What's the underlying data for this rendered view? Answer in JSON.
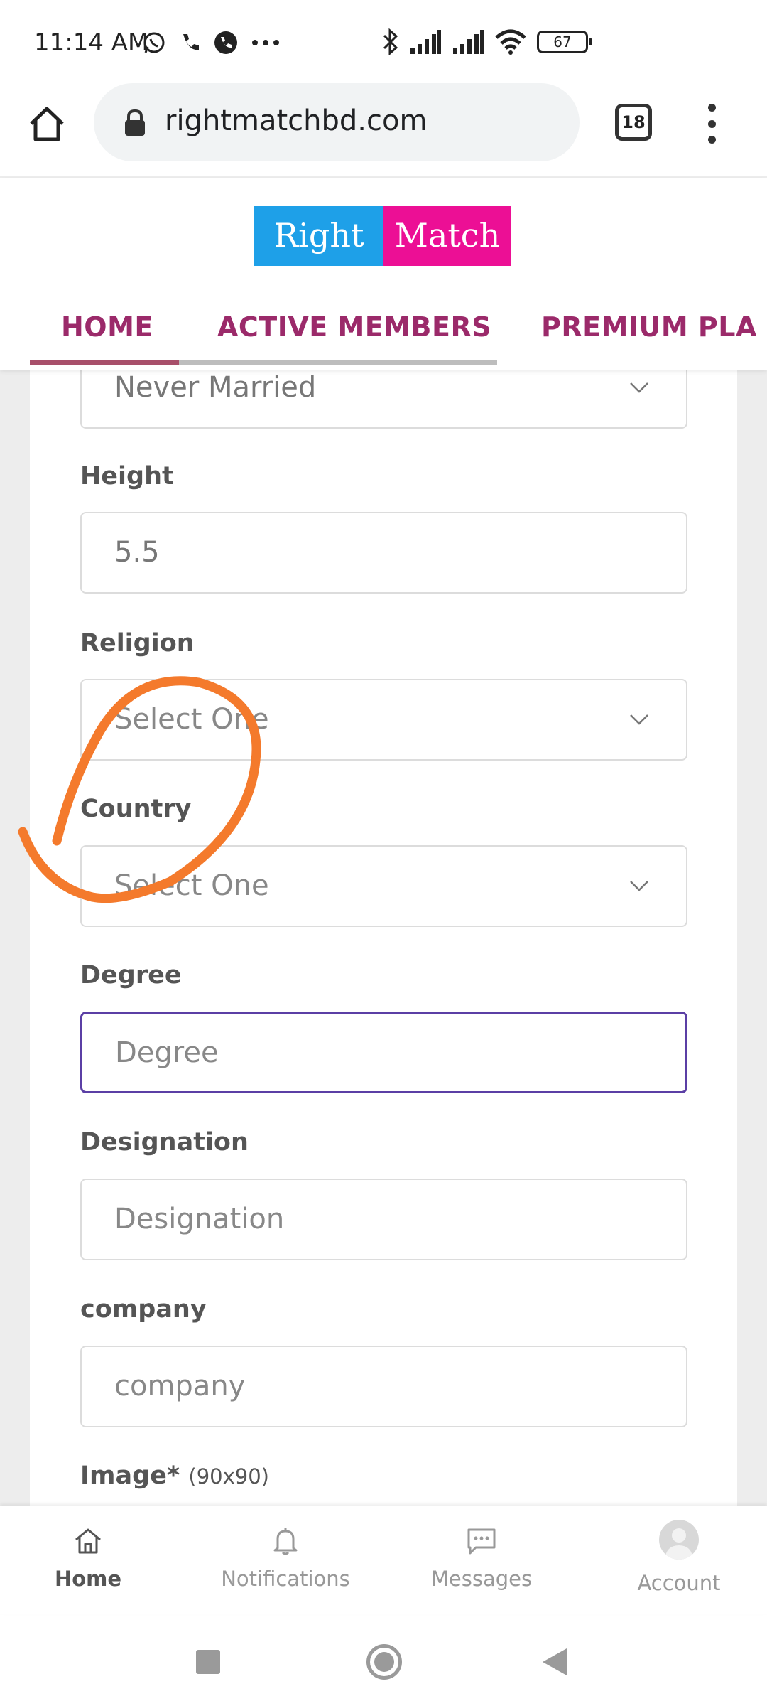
{
  "status_bar": {
    "time": "11:14 AM",
    "icons_left": [
      "whatsapp-icon",
      "phone-icon",
      "whatsapp-call-icon",
      "more-icon"
    ],
    "icons_right": [
      "bluetooth-icon",
      "signal-icon",
      "signal-icon",
      "wifi-icon"
    ],
    "battery": "67"
  },
  "browser": {
    "url": "rightmatchbd.com",
    "tab_count": "18"
  },
  "site": {
    "logo_left": "Right",
    "logo_right": "Match",
    "logo_colors": {
      "left": "#1ea0e8",
      "right": "#ec0f95"
    },
    "nav": [
      "HOME",
      "ACTIVE MEMBERS",
      "PREMIUM PLA"
    ],
    "nav_color": "#9b2a6a"
  },
  "form": {
    "marital_status_value": "Never Married",
    "height_label": "Height",
    "height_value": "5.5",
    "religion_label": "Religion",
    "religion_placeholder": "Select One",
    "country_label": "Country",
    "country_placeholder": "Select One",
    "degree_label": "Degree",
    "degree_placeholder": "Degree",
    "designation_label": "Designation",
    "designation_placeholder": "Designation",
    "company_label": "company",
    "company_placeholder": "company",
    "image_label": "Image*",
    "image_hint": "(90x90)"
  },
  "bottom_nav": [
    {
      "label": "Home",
      "icon": "home-icon"
    },
    {
      "label": "Notifications",
      "icon": "bell-icon"
    },
    {
      "label": "Messages",
      "icon": "message-icon"
    },
    {
      "label": "Account",
      "icon": "avatar-icon"
    }
  ],
  "annotation_color": "#f47a2c"
}
